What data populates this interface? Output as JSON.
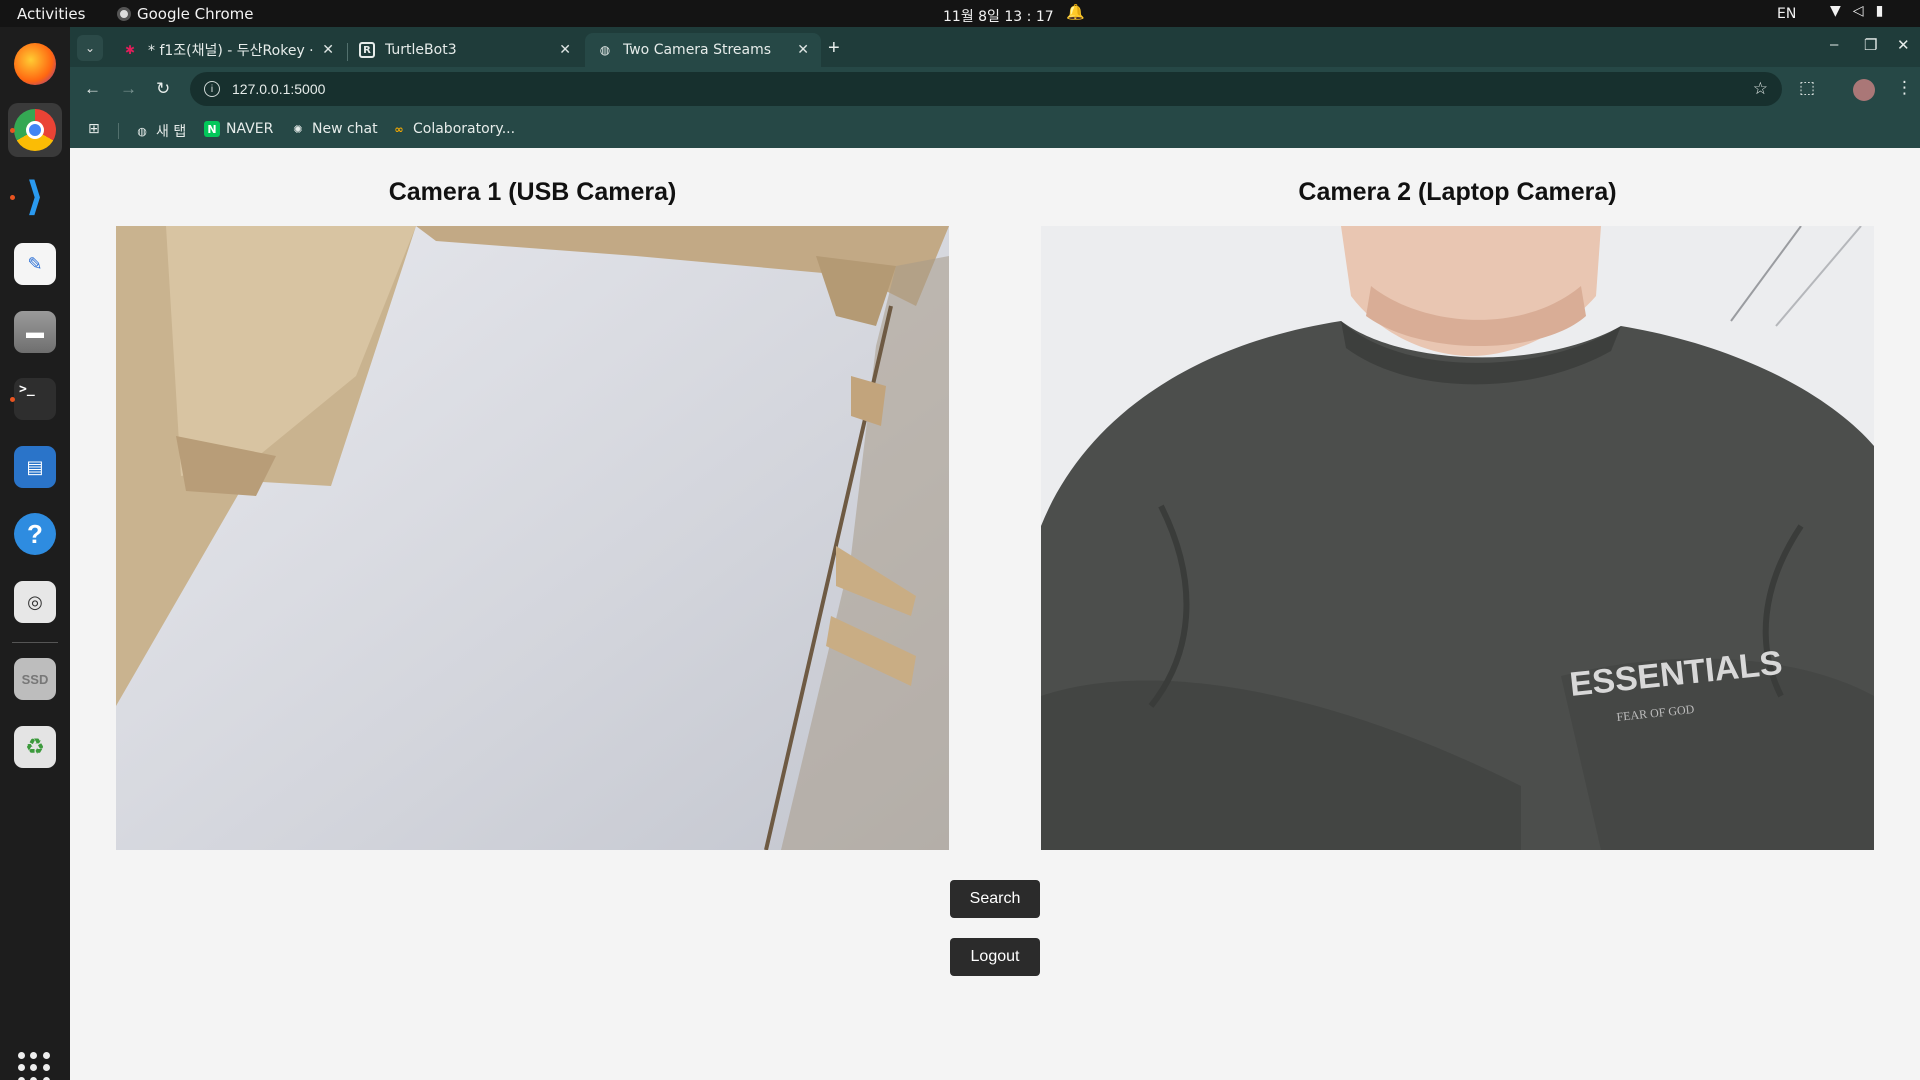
{
  "topbar": {
    "activities": "Activities",
    "app_name": "Google Chrome",
    "clock": "11월 8일  13 : 17",
    "lang": "EN"
  },
  "browser": {
    "tabs": [
      {
        "title": "* f1조(채널) - 두산Rokey ·",
        "active": false
      },
      {
        "title": "TurtleBot3",
        "active": false
      },
      {
        "title": "Two Camera Streams",
        "active": true
      }
    ],
    "url": "127.0.0.1:5000",
    "bookmarks": [
      {
        "label": "새 탭"
      },
      {
        "label": "NAVER"
      },
      {
        "label": "New chat"
      },
      {
        "label": "Colaboratory..."
      }
    ]
  },
  "page": {
    "camera1": {
      "title": "Camera 1 (USB Camera)"
    },
    "camera2": {
      "title": "Camera 2 (Laptop Camera)",
      "shirt_text": "ESSENTIALS",
      "shirt_subtext": "FEAR OF GOD"
    },
    "search_label": "Search",
    "logout_label": "Logout"
  },
  "colors": {
    "tabstrip": "#1f3c3a",
    "toolbar": "#264846",
    "page_bg": "#f4f4f4",
    "button_bg": "#2b2b2b"
  }
}
